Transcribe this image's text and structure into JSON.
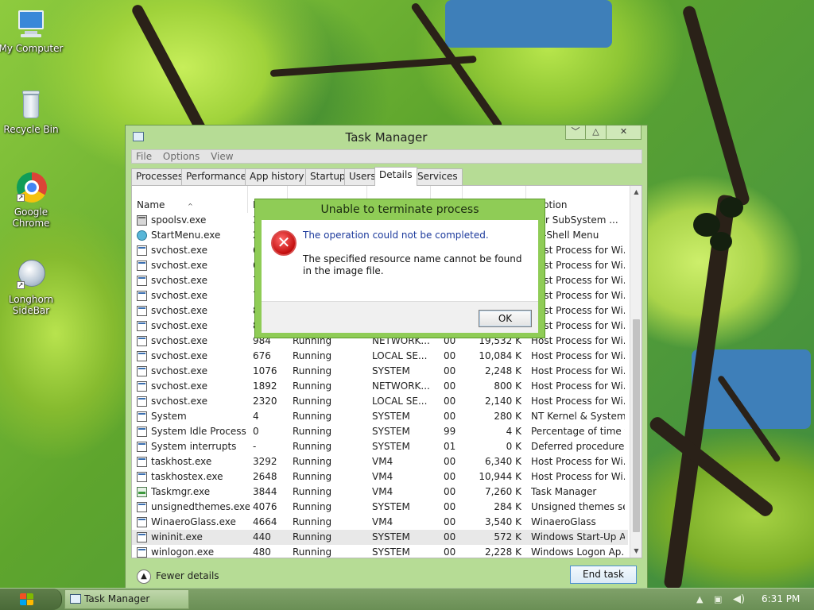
{
  "desktop": {
    "icons": [
      {
        "label": "My Computer",
        "icon": "computer-icon"
      },
      {
        "label": "Recycle Bin",
        "icon": "recycle-bin-icon"
      },
      {
        "label": "Google Chrome",
        "icon": "chrome-icon"
      },
      {
        "label": "Longhorn SideBar",
        "icon": "sidebar-icon"
      }
    ]
  },
  "task_manager": {
    "title": "Task Manager",
    "window_buttons": {
      "minimize": "﹀",
      "maximize": "△",
      "close": "✕"
    },
    "menu": [
      "File",
      "Options",
      "View"
    ],
    "tabs": [
      "Processes",
      "Performance",
      "App history",
      "Startup",
      "Users",
      "Details",
      "Services"
    ],
    "active_tab": "Details",
    "columns": {
      "name": "Name",
      "pid": "P",
      "description": "Description"
    },
    "visible_description_header": "cription",
    "processes": [
      {
        "name": "spoolsv.exe",
        "pid": "3",
        "status": "",
        "user": "",
        "cpu": "",
        "memory": "",
        "description": "oler SubSystem ...",
        "icon": "printer"
      },
      {
        "name": "StartMenu.exe",
        "pid": "2",
        "status": "",
        "user": "",
        "cpu": "",
        "memory": "",
        "description": "en-Shell Menu",
        "icon": "globe"
      },
      {
        "name": "svchost.exe",
        "pid": "6",
        "status": "",
        "user": "",
        "cpu": "",
        "memory": "",
        "description": "Host Process for Wi...",
        "icon": "generic"
      },
      {
        "name": "svchost.exe",
        "pid": "6",
        "status": "",
        "user": "",
        "cpu": "",
        "memory": "",
        "description": "Host Process for Wi...",
        "icon": "generic"
      },
      {
        "name": "svchost.exe",
        "pid": "7",
        "status": "",
        "user": "",
        "cpu": "",
        "memory": "",
        "description": "Host Process for Wi...",
        "icon": "generic"
      },
      {
        "name": "svchost.exe",
        "pid": "7",
        "status": "",
        "user": "",
        "cpu": "",
        "memory": "",
        "description": "Host Process for Wi...",
        "icon": "generic"
      },
      {
        "name": "svchost.exe",
        "pid": "8",
        "status": "",
        "user": "",
        "cpu": "",
        "memory": "",
        "description": "Host Process for Wi...",
        "icon": "generic"
      },
      {
        "name": "svchost.exe",
        "pid": "8",
        "status": "",
        "user": "",
        "cpu": "",
        "memory": "",
        "description": "Host Process for Wi...",
        "icon": "generic"
      },
      {
        "name": "svchost.exe",
        "pid": "984",
        "status": "Running",
        "user": "NETWORK...",
        "cpu": "00",
        "memory": "19,532 K",
        "description": "Host Process for Wi...",
        "icon": "generic"
      },
      {
        "name": "svchost.exe",
        "pid": "676",
        "status": "Running",
        "user": "LOCAL SE...",
        "cpu": "00",
        "memory": "10,084 K",
        "description": "Host Process for Wi...",
        "icon": "generic"
      },
      {
        "name": "svchost.exe",
        "pid": "1076",
        "status": "Running",
        "user": "SYSTEM",
        "cpu": "00",
        "memory": "2,248 K",
        "description": "Host Process for Wi...",
        "icon": "generic"
      },
      {
        "name": "svchost.exe",
        "pid": "1892",
        "status": "Running",
        "user": "NETWORK...",
        "cpu": "00",
        "memory": "800 K",
        "description": "Host Process for Wi...",
        "icon": "generic"
      },
      {
        "name": "svchost.exe",
        "pid": "2320",
        "status": "Running",
        "user": "LOCAL SE...",
        "cpu": "00",
        "memory": "2,140 K",
        "description": "Host Process for Wi...",
        "icon": "generic"
      },
      {
        "name": "System",
        "pid": "4",
        "status": "Running",
        "user": "SYSTEM",
        "cpu": "00",
        "memory": "280 K",
        "description": "NT Kernel & System",
        "icon": "generic"
      },
      {
        "name": "System Idle Process",
        "pid": "0",
        "status": "Running",
        "user": "SYSTEM",
        "cpu": "99",
        "memory": "4 K",
        "description": "Percentage of time t...",
        "icon": "generic"
      },
      {
        "name": "System interrupts",
        "pid": "-",
        "status": "Running",
        "user": "SYSTEM",
        "cpu": "01",
        "memory": "0 K",
        "description": "Deferred procedure ...",
        "icon": "generic"
      },
      {
        "name": "taskhost.exe",
        "pid": "3292",
        "status": "Running",
        "user": "VM4",
        "cpu": "00",
        "memory": "6,340 K",
        "description": "Host Process for Wi...",
        "icon": "generic"
      },
      {
        "name": "taskhostex.exe",
        "pid": "2648",
        "status": "Running",
        "user": "VM4",
        "cpu": "00",
        "memory": "10,944 K",
        "description": "Host Process for Wi...",
        "icon": "generic"
      },
      {
        "name": "Taskmgr.exe",
        "pid": "3844",
        "status": "Running",
        "user": "VM4",
        "cpu": "00",
        "memory": "7,260 K",
        "description": "Task Manager",
        "icon": "taskmgr"
      },
      {
        "name": "unsignedthemes.exe",
        "pid": "4076",
        "status": "Running",
        "user": "SYSTEM",
        "cpu": "00",
        "memory": "284 K",
        "description": "Unsigned themes se...",
        "icon": "generic"
      },
      {
        "name": "WinaeroGlass.exe",
        "pid": "4664",
        "status": "Running",
        "user": "VM4",
        "cpu": "00",
        "memory": "3,540 K",
        "description": "WinaeroGlass",
        "icon": "generic"
      },
      {
        "name": "wininit.exe",
        "pid": "440",
        "status": "Running",
        "user": "SYSTEM",
        "cpu": "00",
        "memory": "572 K",
        "description": "Windows Start-Up A...",
        "icon": "generic",
        "selected": true
      },
      {
        "name": "winlogon.exe",
        "pid": "480",
        "status": "Running",
        "user": "SYSTEM",
        "cpu": "00",
        "memory": "2,228 K",
        "description": "Windows Logon Ap...",
        "icon": "generic"
      }
    ],
    "fewer_details": "Fewer details",
    "end_task": "End task"
  },
  "error_dialog": {
    "title": "Unable to terminate process",
    "main_instruction": "The operation could not be completed.",
    "detail": "The specified resource name cannot be found in the image file.",
    "ok": "OK",
    "icon": "error-icon"
  },
  "taskbar": {
    "item_label": "Task Manager",
    "tray_icons": [
      "chevron-up-icon",
      "network-icon",
      "volume-icon"
    ],
    "clock": "6:31 PM"
  },
  "colors": {
    "window_frame": "#b6dc95",
    "dialog_frame": "#8fcc56",
    "dialog_main_text": "#1c3a9c",
    "taskbar": "#6a8f55"
  }
}
